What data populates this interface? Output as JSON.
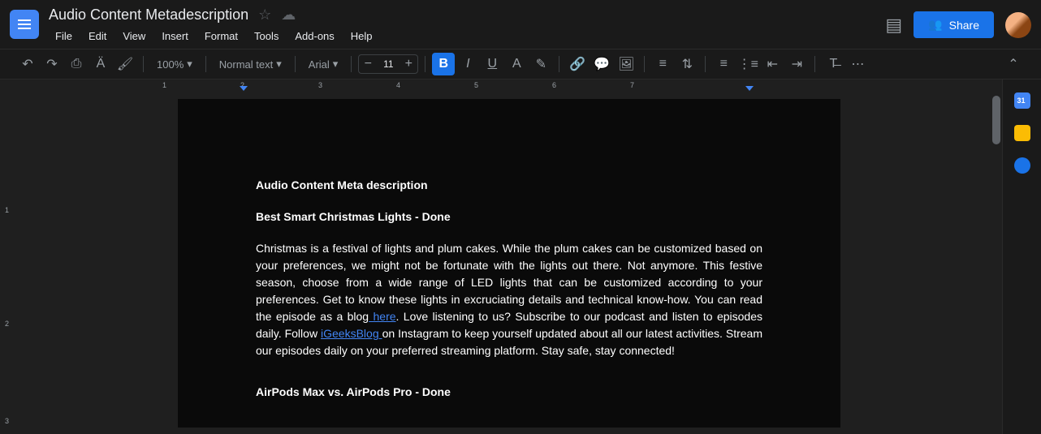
{
  "header": {
    "title": "Audio Content Metadescription",
    "menus": [
      "File",
      "Edit",
      "View",
      "Insert",
      "Format",
      "Tools",
      "Add-ons",
      "Help"
    ],
    "share_label": "Share"
  },
  "toolbar": {
    "zoom": "100%",
    "style": "Normal text",
    "font": "Arial",
    "font_size": "11"
  },
  "ruler_h": [
    "1",
    "2",
    "3",
    "4",
    "5",
    "6",
    "7"
  ],
  "ruler_v": [
    "1",
    "2",
    "3"
  ],
  "document": {
    "heading": "Audio Content Meta description",
    "subheading": "Best Smart Christmas Lights - Done",
    "para_before_link1": "Christmas is a festival of lights and plum cakes. While the plum cakes can be customized based on your preferences, we might not be fortunate with the lights out there. Not anymore. This festive season, choose from a wide range of LED lights that can be customized according to your preferences. Get to know these lights in excruciating details and technical know-how. You can read the episode as a blog",
    "link1_text": " here",
    "para_mid": ". Love listening to us? Subscribe to our podcast and listen to episodes daily. Follow ",
    "link2_text": "iGeeksBlog ",
    "para_after_link2": "on Instagram to keep yourself updated about all our latest activities. Stream our episodes daily on your preferred streaming platform. Stay safe, stay connected!",
    "next_heading": "AirPods Max vs. AirPods Pro - Done"
  }
}
